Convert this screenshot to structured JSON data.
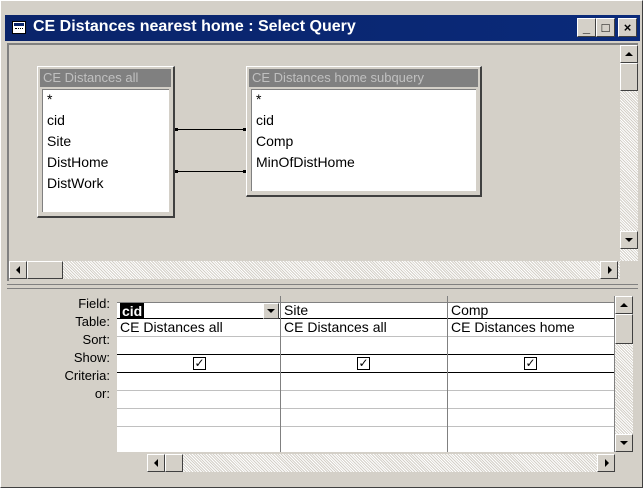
{
  "window": {
    "title": "CE Distances nearest home : Select Query",
    "min_label": "_",
    "max_label": "□",
    "close_label": "×"
  },
  "tables": [
    {
      "title": "CE Distances all",
      "fields": [
        "*",
        "cid",
        "Site",
        "DistHome",
        "DistWork"
      ]
    },
    {
      "title": "CE Distances home subquery",
      "fields": [
        "*",
        "cid",
        "Comp",
        "MinOfDistHome"
      ]
    }
  ],
  "grid": {
    "row_labels": [
      "Field:",
      "Table:",
      "Sort:",
      "Show:",
      "Criteria:",
      "or:"
    ],
    "columns": [
      {
        "field": "cid",
        "table": "CE Distances all",
        "sort": "",
        "show": true,
        "criteria": "",
        "or": ""
      },
      {
        "field": "Site",
        "table": "CE Distances all",
        "sort": "",
        "show": true,
        "criteria": "",
        "or": ""
      },
      {
        "field": "Comp",
        "table": "CE Distances home",
        "sort": "",
        "show": true,
        "criteria": "",
        "or": ""
      }
    ],
    "check_glyph": "✓"
  }
}
